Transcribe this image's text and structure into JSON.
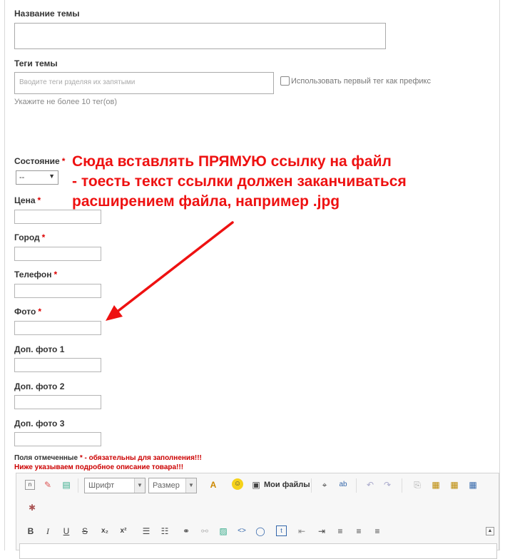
{
  "form": {
    "topic_title_label": "Название темы",
    "tags_label": "Теги темы",
    "tags_placeholder": "Вводите теги рзделяя их запятыми",
    "prefix_checkbox_label": "Использовать первый тег как префикс",
    "tags_hint": "Укажите не более 10 тег(ов)",
    "condition_label": "Состояние",
    "condition_value": "--",
    "required_mark": "*",
    "fields": [
      {
        "label": "Цена",
        "required": true
      },
      {
        "label": "Город",
        "required": true
      },
      {
        "label": "Телефон",
        "required": true
      },
      {
        "label": "Фото",
        "required": true
      },
      {
        "label": "Доп. фото 1",
        "required": false
      },
      {
        "label": "Доп. фото 2",
        "required": false
      },
      {
        "label": "Доп. фото 3",
        "required": false
      }
    ],
    "required_note_prefix": "Поля отмеченные",
    "required_note_suffix": " - обязательны для заполнения!!!",
    "description_note": "Ниже указываем подробное описание товара!!!"
  },
  "annotation": {
    "line1": "Сюда вставлять ПРЯМУЮ ссылку на файл",
    "line2": "- тоесть текст ссылки должен заканчиваться",
    "line3": "расширением файла, например .jpg",
    "color": "#ee1111"
  },
  "editor": {
    "font_combo": "Шрифт",
    "size_combo": "Размер",
    "my_files_label": "Мои файлы",
    "format_buttons": [
      "B",
      "I",
      "U",
      "S"
    ]
  }
}
